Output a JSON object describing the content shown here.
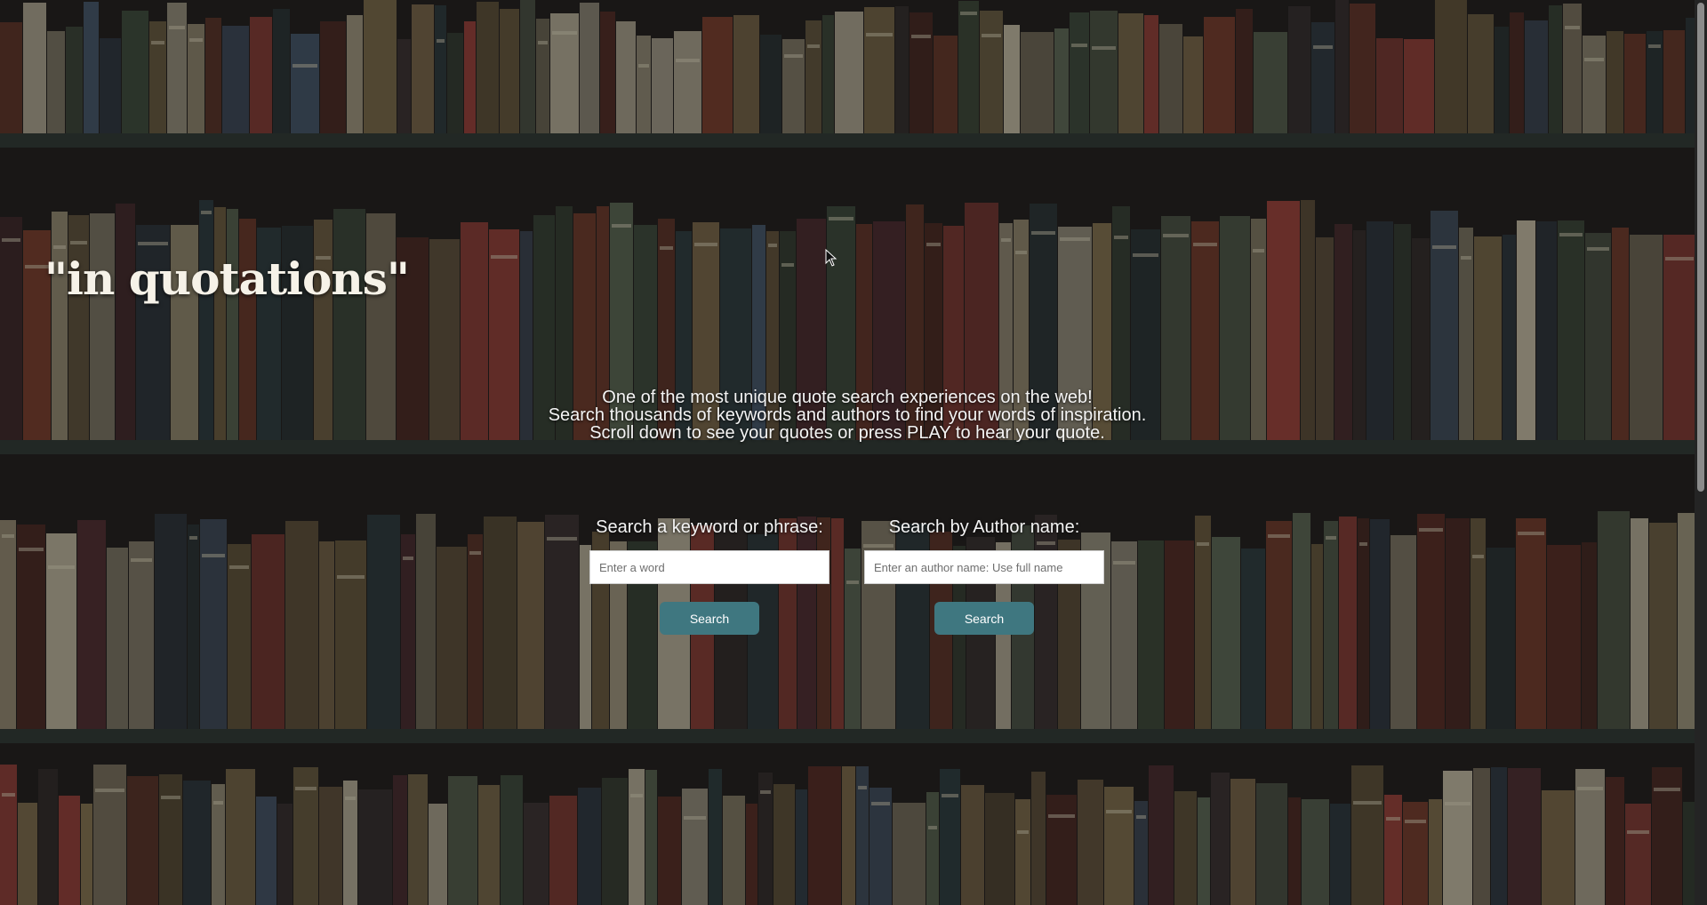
{
  "site": {
    "logo": "\"in quotations\""
  },
  "intro": {
    "line1": "One of the most unique quote search experiences on the web!",
    "line2": "Search thousands of keywords and authors to find your words of inspiration.",
    "line3": "Scroll down to see your quotes or press PLAY to hear your quote."
  },
  "keyword_search": {
    "label": "Search a keyword or phrase:",
    "placeholder": "Enter a word",
    "value": "",
    "button_label": "Search"
  },
  "author_search": {
    "label": "Search by Author name:",
    "placeholder": "Enter an author name: Use full name",
    "value": "",
    "button_label": "Search"
  },
  "colors": {
    "button_bg": "#3f7780",
    "text": "#f4f4f4",
    "logo": "#f6f2e8"
  },
  "icons": {
    "cursor": "mouse-pointer-icon"
  }
}
